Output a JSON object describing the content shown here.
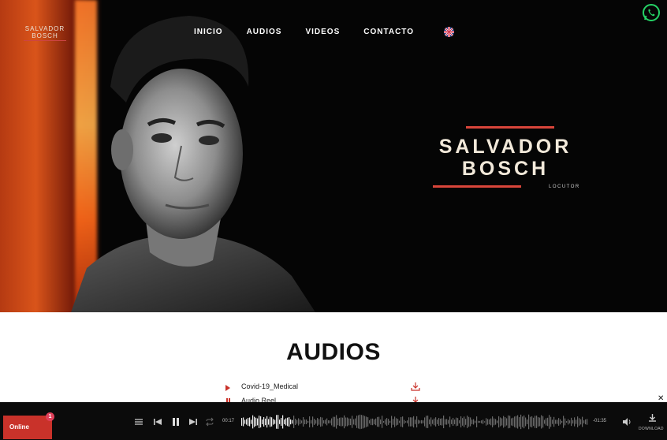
{
  "logo": {
    "line1": "SALVADOR",
    "line2": "BOSCH"
  },
  "nav": {
    "items": [
      "INICIO",
      "AUDIOS",
      "VIDEOS",
      "CONTACTO"
    ]
  },
  "brand": {
    "name_line1": "SALVADOR",
    "name_line2": "BOSCH",
    "role": "LOCUTOR"
  },
  "section": {
    "title": "AUDIOS"
  },
  "tracks": [
    {
      "name": "Covid-19_Medical"
    },
    {
      "name": "Audio Reel"
    }
  ],
  "player": {
    "online_label": "Online",
    "badge_count": "1",
    "elapsed": "00:17",
    "remaining": "-01:35",
    "download_label": "DOWNLOAD",
    "progress": 0.15
  },
  "colors": {
    "accent": "#c9322a",
    "hero_bg": "#050505",
    "player_bg": "#0b0b0b",
    "whatsapp": "#25d366"
  }
}
